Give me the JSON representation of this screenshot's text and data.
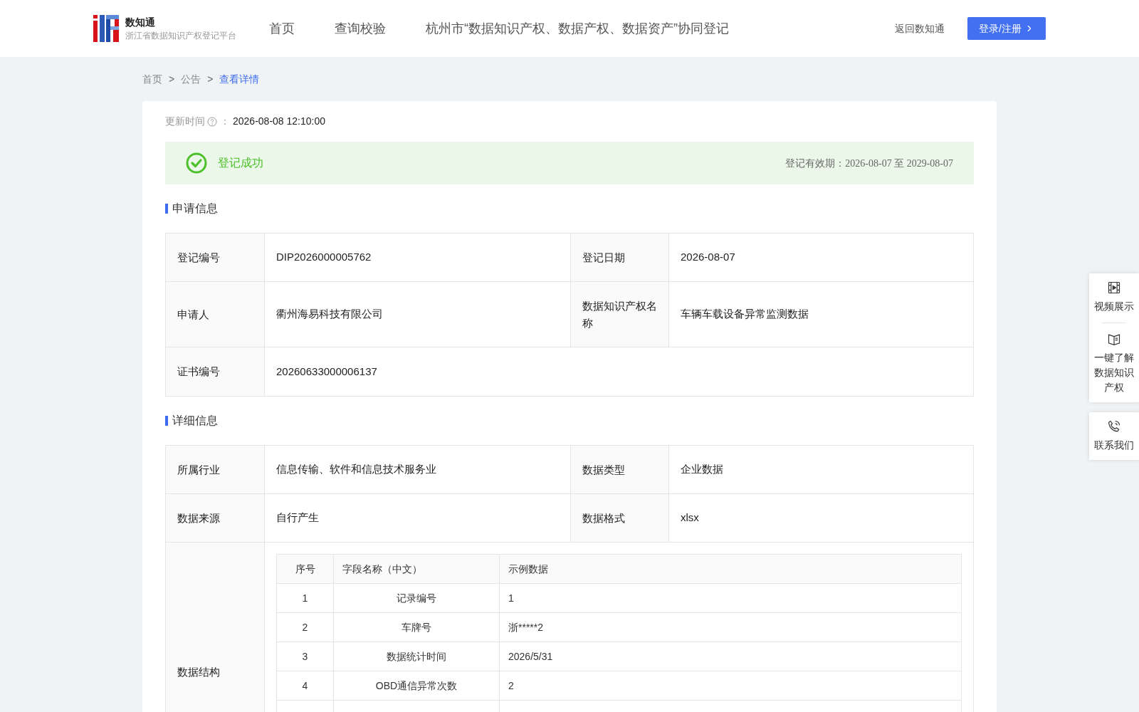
{
  "header": {
    "logo": {
      "name": "数知通",
      "subtitle": "浙江省数据知识产权登记平台"
    },
    "nav": [
      "首页",
      "查询校验",
      "杭州市“数据知识产权、数据产权、数据资产”协同登记"
    ],
    "back_link": "返回数知通",
    "login_button": "登录/注册"
  },
  "breadcrumb": [
    {
      "label": "首页",
      "selected": false
    },
    {
      "label": "公告",
      "selected": false
    },
    {
      "label": "查看详情",
      "selected": true
    }
  ],
  "breadcrumb_separator": ">",
  "update": {
    "label": "更新时间",
    "separator": "：",
    "value": "2026-08-08 12:10:00"
  },
  "status": {
    "kind": "success",
    "text": "登记成功",
    "validity": "登记有效期：2026-08-07 至 2029-08-07"
  },
  "application": {
    "title": "申请信息",
    "rows": [
      [
        {
          "label": "登记编号",
          "value": "DIP2026000005762"
        },
        {
          "label": "登记日期",
          "value": "2026-08-07"
        }
      ],
      [
        {
          "label": "申请人",
          "value": "衢州海易科技有限公司"
        },
        {
          "label": "数据知识产权名称",
          "value": "车辆车载设备异常监测数据"
        }
      ],
      [
        {
          "label": "证书编号",
          "value": "20260633000006137"
        }
      ]
    ]
  },
  "details": {
    "title": "详细信息",
    "rows": [
      [
        {
          "label": "所属行业",
          "value": "信息传输、软件和信息技术服务业"
        },
        {
          "label": "数据类型",
          "value": "企业数据"
        }
      ],
      [
        {
          "label": "数据来源",
          "value": "自行产生"
        },
        {
          "label": "数据格式",
          "value": "xlsx"
        }
      ]
    ],
    "structure": {
      "label": "数据结构",
      "columns": [
        "序号",
        "字段名称（中文）",
        "示例数据"
      ],
      "rows": [
        [
          "1",
          "记录编号",
          "1"
        ],
        [
          "2",
          "车牌号",
          "浙*****2"
        ],
        [
          "3",
          "数据统计时间",
          "2026/5/31"
        ],
        [
          "4",
          "OBD通信异常次数",
          "2"
        ]
      ]
    }
  },
  "float_panel": [
    {
      "kind": "video",
      "label": "视频展示"
    },
    {
      "kind": "book",
      "label": "一键了解数据知识产权"
    },
    {
      "kind": "phone",
      "label": "联系我们"
    }
  ]
}
